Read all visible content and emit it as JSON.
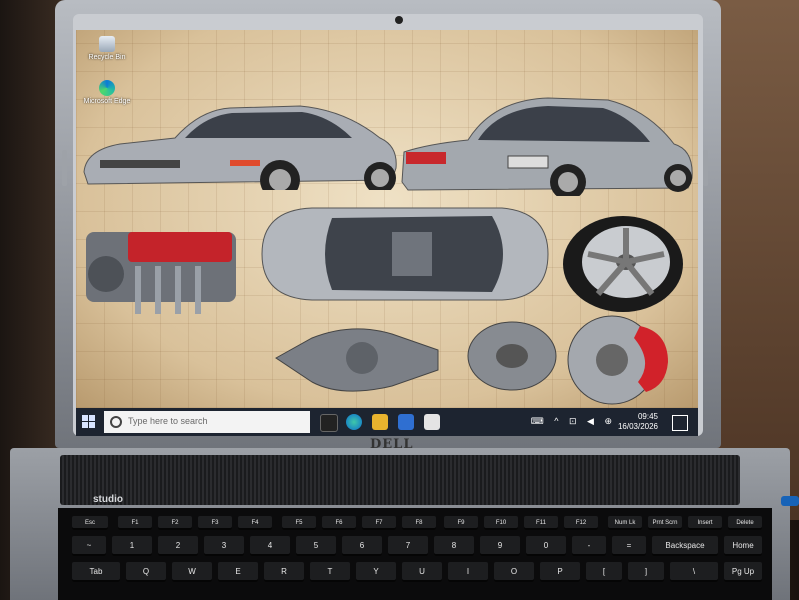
{
  "desktop": {
    "icons": [
      {
        "label": "Recycle Bin",
        "icon": "recycle-bin-icon"
      },
      {
        "label": "Microsoft Edge",
        "icon": "edge-icon"
      }
    ]
  },
  "taskbar": {
    "search_placeholder": "Type here to search",
    "time": "09:45",
    "date": "16/03/2026",
    "pinned": [
      "edge-icon",
      "folder-icon",
      "store-icon",
      "mail-icon"
    ],
    "tray_icons": [
      "keyboard-icon",
      "chevron-up-icon",
      "network-icon",
      "volume-icon",
      "language-icon"
    ]
  },
  "laptop": {
    "brand": "DELL",
    "model": "studio"
  },
  "keyboard": {
    "function_row": [
      "Esc",
      "F1",
      "F2",
      "F3",
      "F4",
      "F5",
      "F6",
      "F7",
      "F8",
      "F9",
      "F10",
      "F11",
      "F12",
      "Num Lk",
      "Prnt Scrn",
      "Insert",
      "Delete"
    ],
    "number_row": [
      "~",
      "1",
      "2",
      "3",
      "4",
      "5",
      "6",
      "7",
      "8",
      "9",
      "0",
      "-",
      "=",
      "Backspace",
      "Home"
    ],
    "top_row": [
      "Tab",
      "Q",
      "W",
      "E",
      "R",
      "T",
      "Y",
      "U",
      "I",
      "O",
      "P",
      "[",
      "]",
      "\\",
      "Pg Up"
    ]
  },
  "colors": {
    "taskbar": "#1d2430",
    "wallpaper": "#d8c4a0",
    "car_silver": "#aeb2b8",
    "brake_caliper": "#d1222a",
    "engine_red": "#c4232a"
  }
}
